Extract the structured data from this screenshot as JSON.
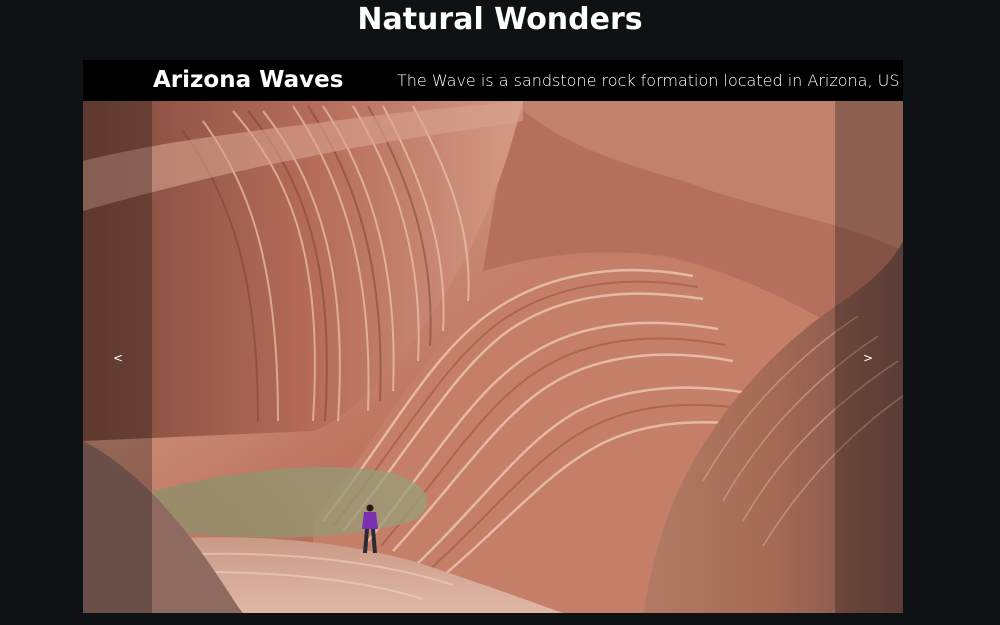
{
  "page": {
    "title": "Natural Wonders"
  },
  "slider": {
    "slide": {
      "title": "Arizona Waves",
      "description": "The Wave is a sandstone rock formation located in Arizona, US",
      "image_subject": "sandstone-wave-canyon-photo"
    },
    "prev_label": "<",
    "next_label": ">"
  },
  "colors": {
    "background": "#0e1214",
    "caption_bar": "#000000",
    "text": "#ffffff"
  }
}
